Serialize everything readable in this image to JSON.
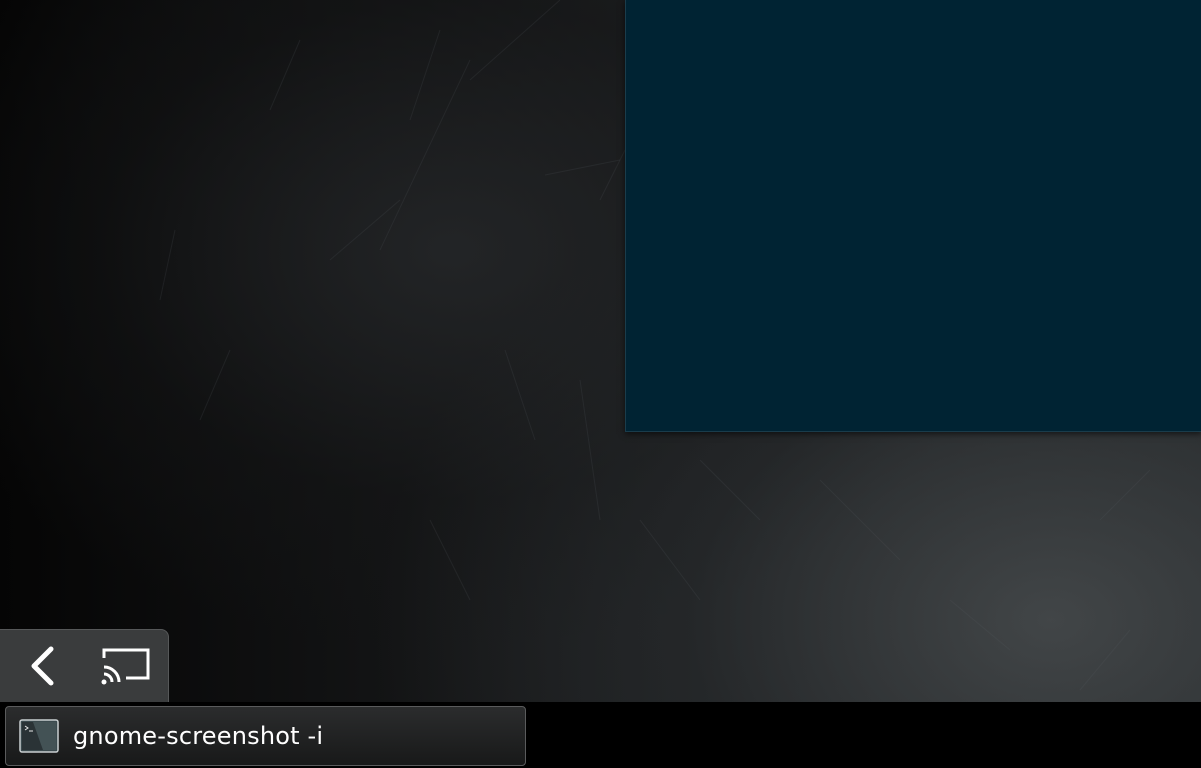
{
  "desktop": {
    "app_window_color": "#002333"
  },
  "dash": {
    "items": [
      {
        "name": "back",
        "icon": "chevron-left-icon"
      },
      {
        "name": "cast",
        "icon": "cast-icon"
      }
    ],
    "background": "#3a3c3d"
  },
  "taskbar": {
    "tasks": [
      {
        "label": "gnome-screenshot -i",
        "icon": "terminal-icon"
      }
    ]
  }
}
